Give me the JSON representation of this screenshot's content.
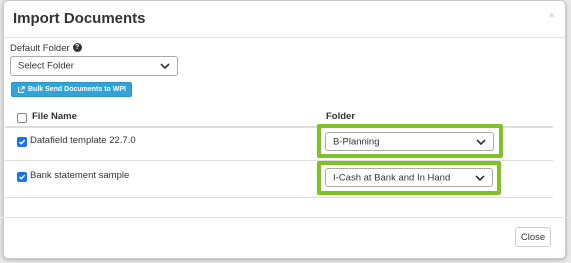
{
  "modal": {
    "title": "Import Documents",
    "close_glyph": "×"
  },
  "default_folder": {
    "label": "Default Folder",
    "help_icon": "question-circle-icon",
    "help_glyph": "?",
    "selected": "Select Folder"
  },
  "bulk_button": {
    "icon": "send-icon",
    "label": "Bulk Send Documents to WPI"
  },
  "table": {
    "headers": {
      "file_name": "File Name",
      "folder": "Folder"
    },
    "header_checkbox_checked": false,
    "rows": [
      {
        "checked": true,
        "file_name": "Datafield template 22.7.0",
        "folder": "B-Planning"
      },
      {
        "checked": true,
        "file_name": "Bank statement sample",
        "folder": "I-Cash at Bank and In Hand"
      }
    ]
  },
  "highlight_color": "#7fc127",
  "accent_color": "#2fa4d8",
  "checkbox_color": "#1a73e8",
  "footer": {
    "close_label": "Close"
  }
}
